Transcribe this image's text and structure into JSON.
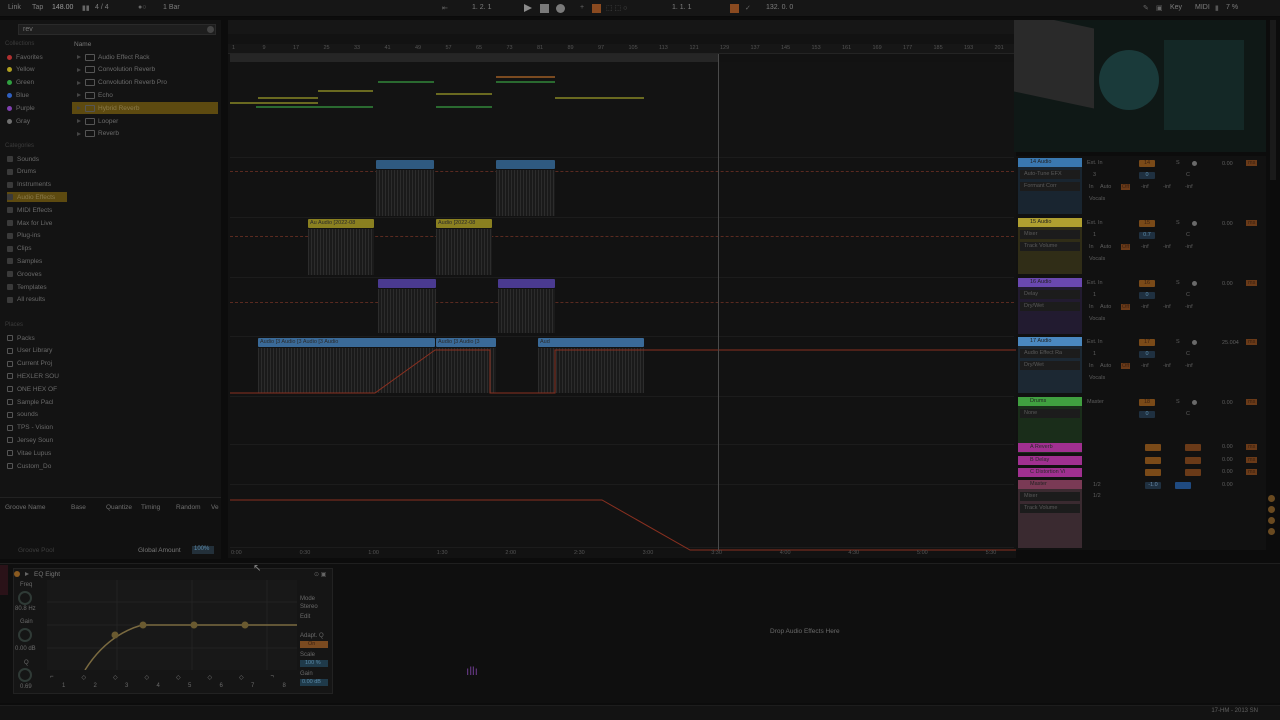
{
  "transport": {
    "link": "Link",
    "tap": "Tap",
    "tempo": "148.00",
    "signature": "4 / 4",
    "quantize": "1 Bar",
    "position": "1.  2.  1",
    "loop_start": "1.  1.  1",
    "loop_length": "132.  0.  0",
    "key": "Key",
    "midi": "MIDI",
    "cpu": "7 %"
  },
  "browser": {
    "search_value": "rev",
    "collections_header": "Collections",
    "collections": [
      {
        "label": "Favorites",
        "color": "#b03030"
      },
      {
        "label": "Yellow",
        "color": "#b0a020"
      },
      {
        "label": "Green",
        "color": "#30a040"
      },
      {
        "label": "Blue",
        "color": "#3060c0"
      },
      {
        "label": "Purple",
        "color": "#8040b0"
      },
      {
        "label": "Gray",
        "color": "#707070"
      }
    ],
    "categories_header": "Categories",
    "categories": [
      "Sounds",
      "Drums",
      "Instruments",
      "Audio Effects",
      "MIDI Effects",
      "Max for Live",
      "Plug-ins",
      "Clips",
      "Samples",
      "Grooves",
      "Templates",
      "All results"
    ],
    "places_header": "Places",
    "places": [
      "Packs",
      "User Library",
      "Current Proj",
      "HEXLER SOU",
      "ONE HEX OF",
      "Sample Pacl",
      "sounds",
      "TPS - Vision",
      "Jersey Soun",
      "Vitae Lupus",
      "Custom_Do"
    ],
    "name_header": "Name",
    "results": [
      "Audio Effect Rack",
      "Convolution Reverb",
      "Convolution Reverb Pro",
      "Echo",
      "Hybrid Reverb",
      "Looper",
      "Reverb"
    ],
    "selected_result": "Hybrid Reverb"
  },
  "groove": {
    "columns": [
      "Groove Name",
      "Base",
      "Quantize",
      "Timing",
      "Random",
      "Ve"
    ],
    "pool_label": "Groove Pool",
    "global_amount_label": "Global Amount",
    "global_amount": "100%"
  },
  "arrangement": {
    "ruler_ticks": [
      "1",
      "9",
      "17",
      "25",
      "33",
      "41",
      "49",
      "57",
      "65",
      "73",
      "81",
      "89",
      "97",
      "105",
      "113",
      "121",
      "129",
      "137",
      "145",
      "153",
      "161",
      "169",
      "177",
      "185",
      "193",
      "201"
    ],
    "time_ticks": [
      "0:00",
      "0:30",
      "1:00",
      "1:30",
      "2:00",
      "2:30",
      "3:00",
      "3:30",
      "4:00",
      "4:30",
      "5:00",
      "5:30"
    ],
    "clips_track15": [
      "Au Audio [2022-08",
      "Audio [2022-08"
    ],
    "clips_track17": "Audio [3 Audio [3 Audio [3 Audio",
    "clips_track17b": "Audio [3 Audio [3",
    "clips_track17c": "Aud"
  },
  "mixer": {
    "tracks": [
      {
        "name": "14 Audio",
        "color": "#3a78b0",
        "device": "Auto-Tune EFX",
        "param": "Formant Corr",
        "input": "Ext. In",
        "channel": "3",
        "route": "Vocals",
        "vol": "14",
        "pan": "0",
        "db": "0.00",
        "mute": "ms"
      },
      {
        "name": "15 Audio",
        "color": "#b0a030",
        "device": "Mixer",
        "param": "Track Volume",
        "input": "Ext. In",
        "channel": "1",
        "route": "Vocals",
        "vol": "15",
        "pan": "0.7",
        "db": "0.00",
        "mute": "ms"
      },
      {
        "name": "16 Audio",
        "color": "#6a48b0",
        "device": "Delay",
        "param": "Dry/Wet",
        "input": "Ext. In",
        "channel": "1",
        "route": "Vocals",
        "vol": "16",
        "pan": "0",
        "db": "0.00",
        "mute": "ms"
      },
      {
        "name": "17 Audio",
        "color": "#4a88c0",
        "device": "Audio Effect Ra",
        "param": "Dry/Wet",
        "input": "Ext. In",
        "channel": "1",
        "route": "Vocals",
        "vol": "17",
        "pan": "0",
        "db": "25.004",
        "mute": "ms"
      },
      {
        "name": "Drums",
        "color": "#40a040",
        "device": "None",
        "param": "",
        "input": "Master",
        "channel": "",
        "route": "",
        "vol": "18",
        "pan": "0",
        "db": "0.00",
        "mute": "ms"
      }
    ],
    "returns": [
      {
        "name": "A Reverb",
        "color": "#a03090"
      },
      {
        "name": "B Delay",
        "color": "#a03090"
      },
      {
        "name": "C Distortion Vi",
        "color": "#a03090"
      }
    ],
    "master": {
      "name": "Master",
      "device": "Mixer",
      "param": "Track Volume",
      "cue": "1/2",
      "cue2": "1/2",
      "vol": "-1.0",
      "db": "0.00"
    },
    "io_labels": {
      "in": "In",
      "auto": "Auto",
      "off": "Off",
      "neg_inf": "-inf"
    }
  },
  "device": {
    "name": "EQ Eight",
    "freq_label": "Freq",
    "freq_value": "80.8 Hz",
    "gain_label": "Gain",
    "gain_value": "0.00 dB",
    "q_label": "Q",
    "q_value": "0.69",
    "mode_label": "Mode",
    "mode_value": "Stereo",
    "edit_label": "Edit",
    "adapt_label": "Adapt. Q",
    "adapt_value": "On",
    "scale_label": "Scale",
    "scale_value": "100 %",
    "out_gain_label": "Gain",
    "out_gain_value": "0.00 dB",
    "bands": [
      "1",
      "2",
      "3",
      "4",
      "5",
      "6",
      "7",
      "8"
    ],
    "drop_hint": "Drop Audio Effects Here"
  },
  "status": {
    "right": "17-HM - 2013 SN"
  }
}
